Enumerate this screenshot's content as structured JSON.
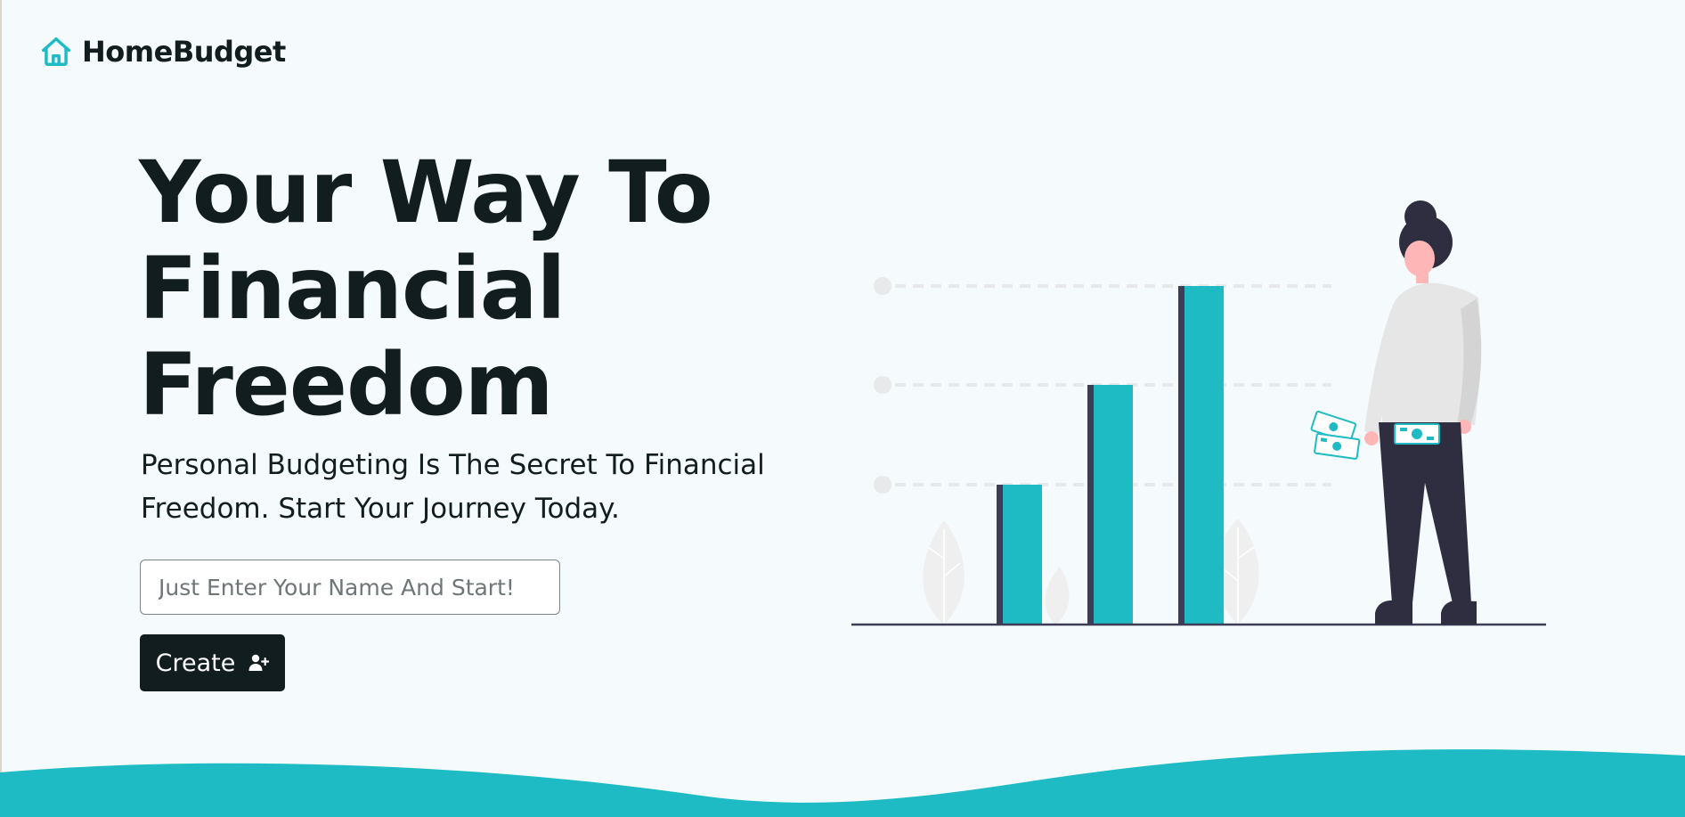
{
  "app": {
    "brand_name": "HomeBudget"
  },
  "hero": {
    "title_lines": [
      "Your Way To",
      "Financial",
      "Freedom"
    ],
    "subtitle_lines": [
      "Personal Budgeting Is The Secret To Financial",
      "Freedom. Start Your Journey Today."
    ]
  },
  "form": {
    "name_placeholder": "Just Enter Your Name And Start!",
    "name_value": "",
    "create_label": "Create"
  },
  "icons": {
    "brand": "home-icon",
    "create": "user-plus-icon"
  },
  "colors": {
    "accent": "#1fbbc4",
    "dark": "#121d1f",
    "background": "#f5fbfc",
    "figure_dark": "#2f2e41"
  }
}
